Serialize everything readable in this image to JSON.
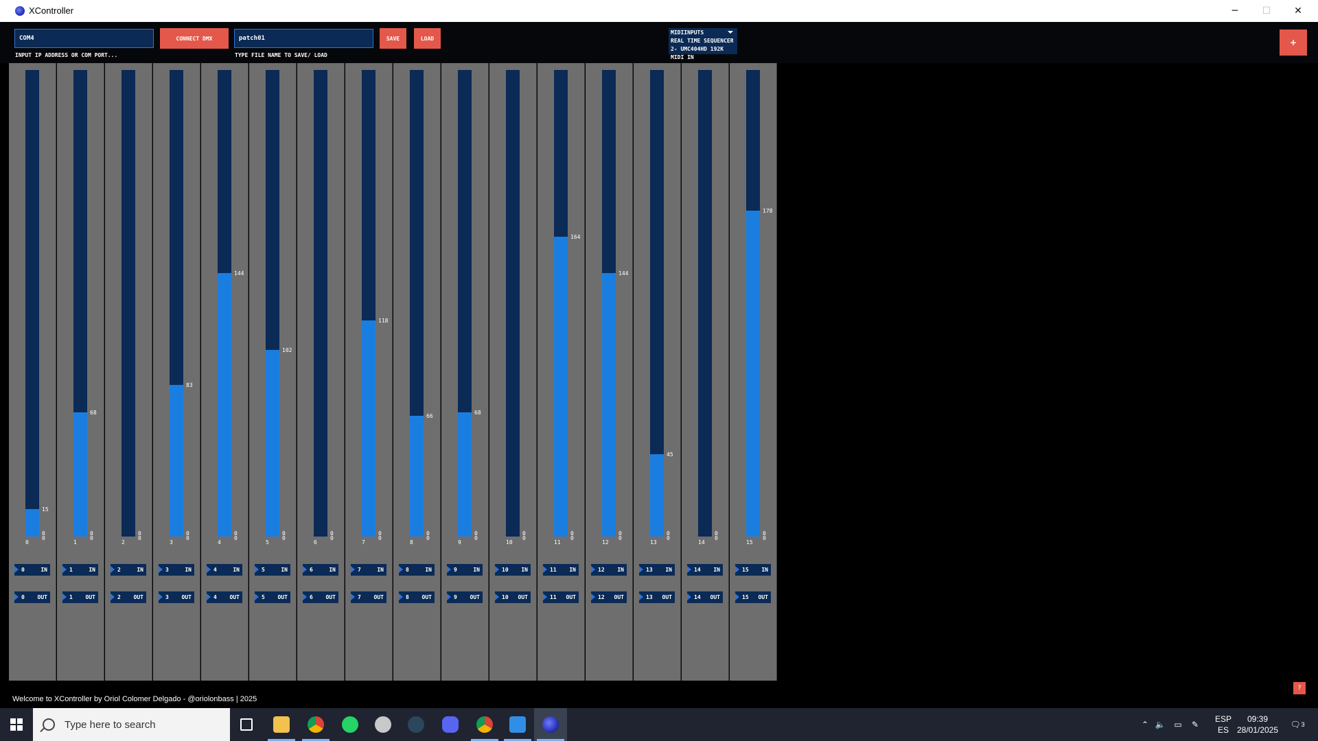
{
  "window": {
    "title": "XController",
    "minimize": "─",
    "maximize": "☐",
    "close": "✕"
  },
  "toolbar": {
    "port_input": "COM4",
    "port_hint": "INPUT IP ADDRESS OR COM PORT...",
    "connect_label": "CONNECT DMX",
    "file_input": "patch01",
    "file_hint": "TYPE FILE NAME TO SAVE/ LOAD",
    "save_label": "SAVE",
    "load_label": "LOAD",
    "midi_lines": [
      "MIDIINPUTS",
      "REAL TIME SEQUENCER",
      "2- UMC404HD 192K MIDI IN"
    ],
    "plus_label": "+"
  },
  "channels": [
    {
      "index": "0",
      "value": 15
    },
    {
      "index": "1",
      "value": 68
    },
    {
      "index": "2",
      "value": 0
    },
    {
      "index": "3",
      "value": 83
    },
    {
      "index": "4",
      "value": 144
    },
    {
      "index": "5",
      "value": 102
    },
    {
      "index": "6",
      "value": 0
    },
    {
      "index": "7",
      "value": 118
    },
    {
      "index": "8",
      "value": 66
    },
    {
      "index": "9",
      "value": 68
    },
    {
      "index": "10",
      "value": 0
    },
    {
      "index": "11",
      "value": 164
    },
    {
      "index": "12",
      "value": 144
    },
    {
      "index": "13",
      "value": 45
    },
    {
      "index": "14",
      "value": 0
    },
    {
      "index": "15",
      "value": 178
    }
  ],
  "channel_max": 255,
  "io_labels": {
    "in": "IN",
    "out": "OUT"
  },
  "status": {
    "welcome": "Welcome to XController by Oriol Colomer Delgado - @oriolonbass | 2025",
    "help_label": "?"
  },
  "taskbar": {
    "search_placeholder": "Type here to search",
    "apps": [
      "task-view",
      "file-explorer",
      "chrome",
      "whatsapp",
      "cloud-app",
      "steam",
      "discord",
      "chrome-alt",
      "cortana-app",
      "xcontroller"
    ],
    "lang_top": "ESP",
    "lang_bottom": "ES",
    "time": "09:39",
    "date": "28/01/2025",
    "notif_count": "3"
  },
  "colors": {
    "accent": "#e4584b",
    "track": "#0b2a55",
    "fill": "#1a7ee0",
    "panel": "#6e6e6e"
  }
}
